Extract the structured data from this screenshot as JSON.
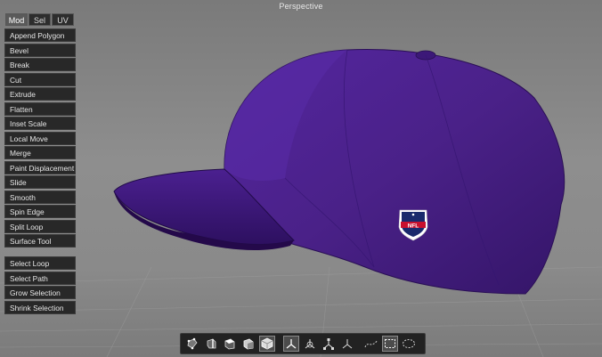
{
  "viewport": {
    "title": "Perspective"
  },
  "tabs": [
    {
      "label": "Mod",
      "active": true
    },
    {
      "label": "Sel",
      "active": false
    },
    {
      "label": "UV",
      "active": false
    }
  ],
  "tools": [
    "Append Polygon",
    "Bevel",
    "Break",
    "Cut",
    "Extrude",
    "Flatten",
    "Inset Scale",
    "Local Move",
    "Merge",
    "Paint Displacement",
    "Slide",
    "Smooth",
    "Spin Edge",
    "Split Loop",
    "Surface Tool"
  ],
  "selection_tools": [
    "Select Loop",
    "Select Path",
    "Grow Selection",
    "Shrink Selection"
  ],
  "model": {
    "logo_text": "NFL",
    "colors": {
      "cap": "#4a2188",
      "cap_shadow": "#2c1258",
      "brim": "#3a1873",
      "logo_blue": "#1a2a6c",
      "logo_red": "#c8102e"
    }
  },
  "toolbar": {
    "buttons": [
      "vertex-mode-icon",
      "edge-mode-icon",
      "face-mode-icon",
      "object-mode-icon",
      "mesh-mode-icon",
      "move-axis-icon",
      "rotate-axis-icon",
      "scale-axis-icon",
      "world-axis-icon",
      "curve-select-icon",
      "rect-select-icon",
      "lasso-select-icon"
    ],
    "active": [
      "mesh-mode-icon",
      "move-axis-icon",
      "rect-select-icon"
    ]
  }
}
